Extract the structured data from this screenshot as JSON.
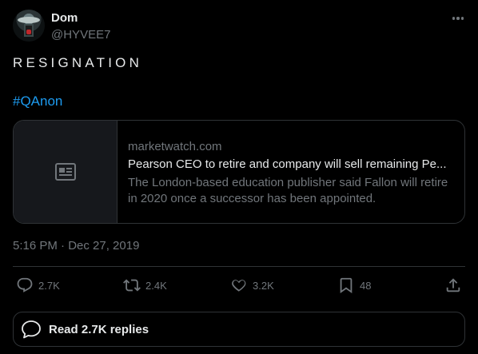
{
  "author": {
    "name": "Dom",
    "handle": "@HYVEE7"
  },
  "tweet": {
    "text": "RESIGNATION",
    "hashtag": "#QAnon",
    "timestamp": "5:16 PM · Dec 27, 2019"
  },
  "card": {
    "domain": "marketwatch.com",
    "title": "Pearson CEO to retire and company will sell remaining Pe...",
    "description": "The London-based education publisher said Fallon will retire in 2020 once a successor has been appointed."
  },
  "actions": {
    "replies": "2.7K",
    "retweets": "2.4K",
    "likes": "3.2K",
    "bookmarks": "48"
  },
  "read_replies": {
    "label": "Read 2.7K replies"
  },
  "colors": {
    "accent": "#1d9bf0",
    "muted": "#71767b",
    "text": "#e7e9ea",
    "border": "#2f3336"
  },
  "icons": [
    "more-icon",
    "news-card-icon",
    "reply-icon",
    "retweet-icon",
    "like-icon",
    "bookmark-icon",
    "share-icon",
    "chat-bubble-icon"
  ]
}
